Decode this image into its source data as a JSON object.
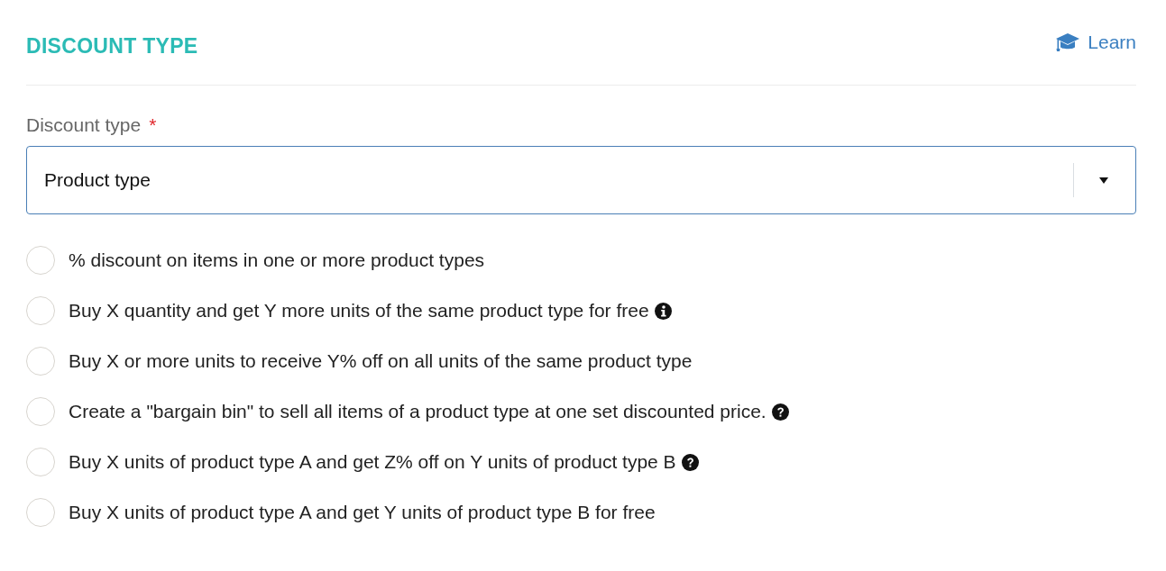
{
  "section": {
    "title": "DISCOUNT TYPE",
    "learn_link": "Learn"
  },
  "field": {
    "label": "Discount type",
    "required_mark": "*",
    "value": "Product type"
  },
  "options": [
    {
      "label": "% discount on items in one or more product types",
      "selected": false,
      "kind": "plain"
    },
    {
      "label": "Buy X quantity and get Y more units of the same product type for free",
      "selected": false,
      "kind": "info"
    },
    {
      "label": "Buy X or more units to receive Y% off on all units of the same product type",
      "selected": false,
      "kind": "plain"
    },
    {
      "label": "Create a \"bargain bin\" to sell all items of a product type at one set discounted price.",
      "selected": false,
      "kind": "help"
    },
    {
      "label": "Buy X units of product type A and get Z% off on Y units of product type B",
      "selected": false,
      "kind": "help"
    },
    {
      "label": "Buy X units of product type A and get Y units of product type B for free",
      "selected": false,
      "kind": "plain"
    }
  ]
}
